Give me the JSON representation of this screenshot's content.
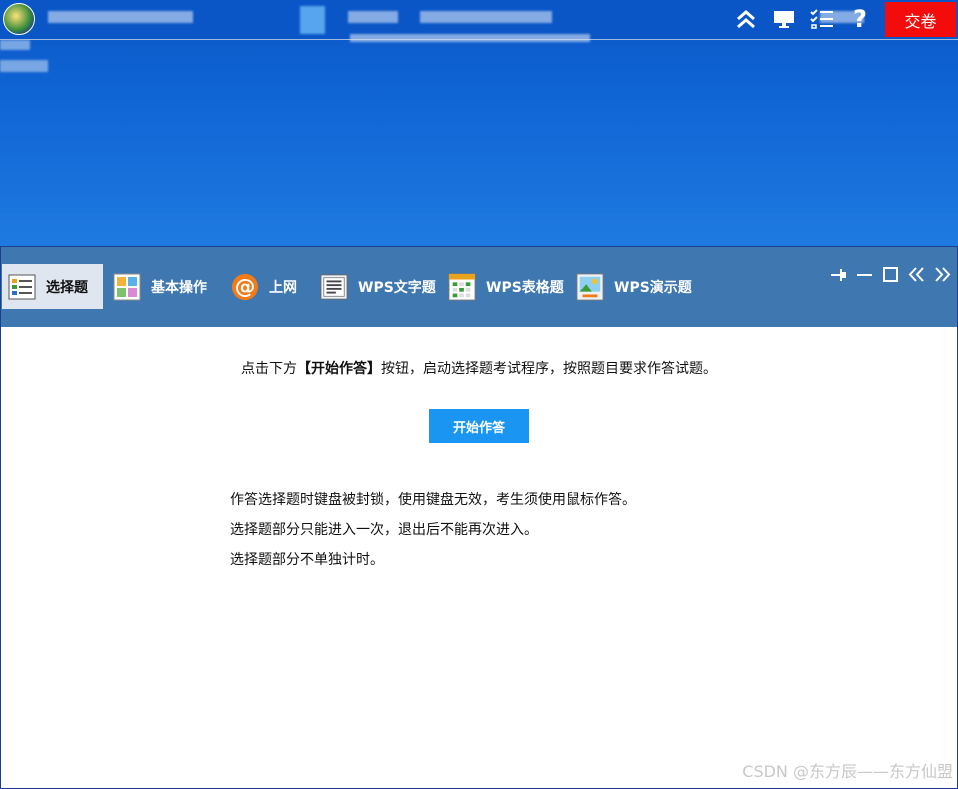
{
  "topbar": {
    "submit_label": "交卷",
    "icons": [
      "double-chevron-up-icon",
      "monitor-icon",
      "checklist-icon",
      "help-icon"
    ],
    "help_label": "?"
  },
  "tabs": [
    {
      "label": "选择题",
      "icon": "choice-question-icon",
      "active": true
    },
    {
      "label": "基本操作",
      "icon": "basic-ops-icon",
      "active": false
    },
    {
      "label": "上网",
      "icon": "internet-at-icon",
      "active": false
    },
    {
      "label": "WPS文字题",
      "icon": "wps-writer-icon",
      "active": false
    },
    {
      "label": "WPS表格题",
      "icon": "wps-sheet-icon",
      "active": false
    },
    {
      "label": "WPS演示题",
      "icon": "wps-presentation-icon",
      "active": false
    }
  ],
  "main": {
    "instruction_prefix": "点击下方",
    "instruction_bold": "【开始作答】",
    "instruction_suffix": "按钮，启动选择题考试程序，按照题目要求作答试题。",
    "start_button": "开始作答",
    "notes": [
      "作答选择题时键盘被封锁，使用键盘无效，考生须使用鼠标作答。",
      "选择题部分只能进入一次，退出后不能再次进入。",
      "选择题部分不单独计时。"
    ]
  },
  "watermark": "CSDN @东方辰——东方仙盟",
  "colors": {
    "desktop_blue": "#0a56c7",
    "tabbar_blue": "#3f78b0",
    "submit_red": "#f40b0b",
    "start_blue": "#1a96f2"
  }
}
